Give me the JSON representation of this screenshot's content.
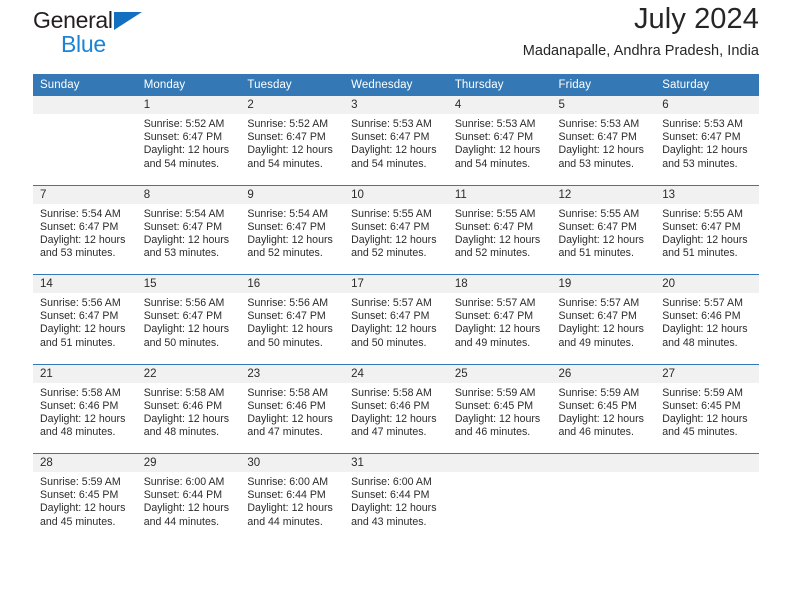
{
  "brand": {
    "name_top": "General",
    "name_bottom": "Blue",
    "triangle_color": "#136fc0",
    "blue_text_color": "#1b84d6"
  },
  "header": {
    "title": "July 2024",
    "subtitle": "Madanapalle, Andhra Pradesh, India"
  },
  "theme": {
    "header_row_bg": "#3479b5",
    "daynum_bg": "#f1f1f1",
    "text_color": "#2b2b2b"
  },
  "weekdays": [
    "Sunday",
    "Monday",
    "Tuesday",
    "Wednesday",
    "Thursday",
    "Friday",
    "Saturday"
  ],
  "labels": {
    "sunrise": "Sunrise:",
    "sunset": "Sunset:",
    "daylight": "Daylight:"
  },
  "weeks": [
    [
      {
        "day": "",
        "empty": true
      },
      {
        "day": "1",
        "sunrise": "Sunrise: 5:52 AM",
        "sunset": "Sunset: 6:47 PM",
        "daylight1": "Daylight: 12 hours",
        "daylight2": "and 54 minutes."
      },
      {
        "day": "2",
        "sunrise": "Sunrise: 5:52 AM",
        "sunset": "Sunset: 6:47 PM",
        "daylight1": "Daylight: 12 hours",
        "daylight2": "and 54 minutes."
      },
      {
        "day": "3",
        "sunrise": "Sunrise: 5:53 AM",
        "sunset": "Sunset: 6:47 PM",
        "daylight1": "Daylight: 12 hours",
        "daylight2": "and 54 minutes."
      },
      {
        "day": "4",
        "sunrise": "Sunrise: 5:53 AM",
        "sunset": "Sunset: 6:47 PM",
        "daylight1": "Daylight: 12 hours",
        "daylight2": "and 54 minutes."
      },
      {
        "day": "5",
        "sunrise": "Sunrise: 5:53 AM",
        "sunset": "Sunset: 6:47 PM",
        "daylight1": "Daylight: 12 hours",
        "daylight2": "and 53 minutes."
      },
      {
        "day": "6",
        "sunrise": "Sunrise: 5:53 AM",
        "sunset": "Sunset: 6:47 PM",
        "daylight1": "Daylight: 12 hours",
        "daylight2": "and 53 minutes."
      }
    ],
    [
      {
        "day": "7",
        "sunrise": "Sunrise: 5:54 AM",
        "sunset": "Sunset: 6:47 PM",
        "daylight1": "Daylight: 12 hours",
        "daylight2": "and 53 minutes."
      },
      {
        "day": "8",
        "sunrise": "Sunrise: 5:54 AM",
        "sunset": "Sunset: 6:47 PM",
        "daylight1": "Daylight: 12 hours",
        "daylight2": "and 53 minutes."
      },
      {
        "day": "9",
        "sunrise": "Sunrise: 5:54 AM",
        "sunset": "Sunset: 6:47 PM",
        "daylight1": "Daylight: 12 hours",
        "daylight2": "and 52 minutes."
      },
      {
        "day": "10",
        "sunrise": "Sunrise: 5:55 AM",
        "sunset": "Sunset: 6:47 PM",
        "daylight1": "Daylight: 12 hours",
        "daylight2": "and 52 minutes."
      },
      {
        "day": "11",
        "sunrise": "Sunrise: 5:55 AM",
        "sunset": "Sunset: 6:47 PM",
        "daylight1": "Daylight: 12 hours",
        "daylight2": "and 52 minutes."
      },
      {
        "day": "12",
        "sunrise": "Sunrise: 5:55 AM",
        "sunset": "Sunset: 6:47 PM",
        "daylight1": "Daylight: 12 hours",
        "daylight2": "and 51 minutes."
      },
      {
        "day": "13",
        "sunrise": "Sunrise: 5:55 AM",
        "sunset": "Sunset: 6:47 PM",
        "daylight1": "Daylight: 12 hours",
        "daylight2": "and 51 minutes."
      }
    ],
    [
      {
        "day": "14",
        "sunrise": "Sunrise: 5:56 AM",
        "sunset": "Sunset: 6:47 PM",
        "daylight1": "Daylight: 12 hours",
        "daylight2": "and 51 minutes."
      },
      {
        "day": "15",
        "sunrise": "Sunrise: 5:56 AM",
        "sunset": "Sunset: 6:47 PM",
        "daylight1": "Daylight: 12 hours",
        "daylight2": "and 50 minutes."
      },
      {
        "day": "16",
        "sunrise": "Sunrise: 5:56 AM",
        "sunset": "Sunset: 6:47 PM",
        "daylight1": "Daylight: 12 hours",
        "daylight2": "and 50 minutes."
      },
      {
        "day": "17",
        "sunrise": "Sunrise: 5:57 AM",
        "sunset": "Sunset: 6:47 PM",
        "daylight1": "Daylight: 12 hours",
        "daylight2": "and 50 minutes."
      },
      {
        "day": "18",
        "sunrise": "Sunrise: 5:57 AM",
        "sunset": "Sunset: 6:47 PM",
        "daylight1": "Daylight: 12 hours",
        "daylight2": "and 49 minutes."
      },
      {
        "day": "19",
        "sunrise": "Sunrise: 5:57 AM",
        "sunset": "Sunset: 6:47 PM",
        "daylight1": "Daylight: 12 hours",
        "daylight2": "and 49 minutes."
      },
      {
        "day": "20",
        "sunrise": "Sunrise: 5:57 AM",
        "sunset": "Sunset: 6:46 PM",
        "daylight1": "Daylight: 12 hours",
        "daylight2": "and 48 minutes."
      }
    ],
    [
      {
        "day": "21",
        "sunrise": "Sunrise: 5:58 AM",
        "sunset": "Sunset: 6:46 PM",
        "daylight1": "Daylight: 12 hours",
        "daylight2": "and 48 minutes."
      },
      {
        "day": "22",
        "sunrise": "Sunrise: 5:58 AM",
        "sunset": "Sunset: 6:46 PM",
        "daylight1": "Daylight: 12 hours",
        "daylight2": "and 48 minutes."
      },
      {
        "day": "23",
        "sunrise": "Sunrise: 5:58 AM",
        "sunset": "Sunset: 6:46 PM",
        "daylight1": "Daylight: 12 hours",
        "daylight2": "and 47 minutes."
      },
      {
        "day": "24",
        "sunrise": "Sunrise: 5:58 AM",
        "sunset": "Sunset: 6:46 PM",
        "daylight1": "Daylight: 12 hours",
        "daylight2": "and 47 minutes."
      },
      {
        "day": "25",
        "sunrise": "Sunrise: 5:59 AM",
        "sunset": "Sunset: 6:45 PM",
        "daylight1": "Daylight: 12 hours",
        "daylight2": "and 46 minutes."
      },
      {
        "day": "26",
        "sunrise": "Sunrise: 5:59 AM",
        "sunset": "Sunset: 6:45 PM",
        "daylight1": "Daylight: 12 hours",
        "daylight2": "and 46 minutes."
      },
      {
        "day": "27",
        "sunrise": "Sunrise: 5:59 AM",
        "sunset": "Sunset: 6:45 PM",
        "daylight1": "Daylight: 12 hours",
        "daylight2": "and 45 minutes."
      }
    ],
    [
      {
        "day": "28",
        "sunrise": "Sunrise: 5:59 AM",
        "sunset": "Sunset: 6:45 PM",
        "daylight1": "Daylight: 12 hours",
        "daylight2": "and 45 minutes."
      },
      {
        "day": "29",
        "sunrise": "Sunrise: 6:00 AM",
        "sunset": "Sunset: 6:44 PM",
        "daylight1": "Daylight: 12 hours",
        "daylight2": "and 44 minutes."
      },
      {
        "day": "30",
        "sunrise": "Sunrise: 6:00 AM",
        "sunset": "Sunset: 6:44 PM",
        "daylight1": "Daylight: 12 hours",
        "daylight2": "and 44 minutes."
      },
      {
        "day": "31",
        "sunrise": "Sunrise: 6:00 AM",
        "sunset": "Sunset: 6:44 PM",
        "daylight1": "Daylight: 12 hours",
        "daylight2": "and 43 minutes."
      },
      {
        "day": "",
        "empty": true
      },
      {
        "day": "",
        "empty": true
      },
      {
        "day": "",
        "empty": true
      }
    ]
  ]
}
